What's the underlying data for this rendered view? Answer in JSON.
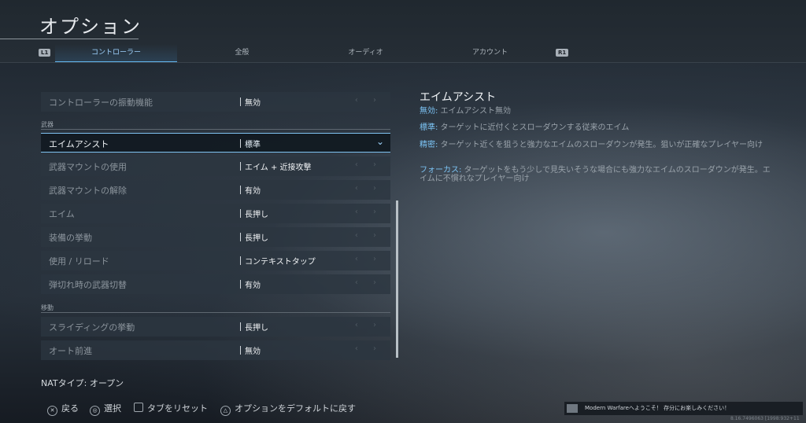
{
  "header": {
    "title": "オプション",
    "bumper_left": "L1",
    "bumper_right": "R1",
    "tabs": [
      {
        "label": "コントローラー"
      },
      {
        "label": "全般"
      },
      {
        "label": "オーディオ"
      },
      {
        "label": "アカウント"
      }
    ]
  },
  "settings": {
    "sections": {
      "weapons": "武器",
      "movement": "移動"
    },
    "rows": [
      {
        "label": "コントローラーの振動機能",
        "value": "無効"
      },
      {
        "label": "エイムアシスト",
        "value": "標準"
      },
      {
        "label": "武器マウントの使用",
        "value": "エイム + 近接攻撃"
      },
      {
        "label": "武器マウントの解除",
        "value": "有効"
      },
      {
        "label": "エイム",
        "value": "長押し"
      },
      {
        "label": "装備の挙動",
        "value": "長押し"
      },
      {
        "label": "使用 / リロード",
        "value": "コンテキストタップ"
      },
      {
        "label": "弾切れ時の武器切替",
        "value": "有効"
      },
      {
        "label": "スライディングの挙動",
        "value": "長押し"
      },
      {
        "label": "オート前進",
        "value": "無効"
      }
    ],
    "selected_index": 1,
    "arrow_glyphs": "‹ ›",
    "chevron_glyph": "⌄"
  },
  "detail": {
    "title": "エイムアシスト",
    "lines": [
      {
        "key": "無効:",
        "text": " エイムアシスト無効"
      },
      {
        "key": "標準:",
        "text": " ターゲットに近付くとスローダウンする従来のエイム"
      },
      {
        "key": "精密:",
        "text": " ターゲット近くを狙うと強力なエイムのスローダウンが発生。狙いが正確なプレイヤー向け"
      },
      {
        "key": "フォーカス:",
        "text": " ターゲットをもう少しで見失いそうな場合にも強力なエイムのスローダウンが発生。エイムに不慣れなプレイヤー向け"
      }
    ]
  },
  "nat": "NATタイプ: オープン",
  "footer": {
    "back": "戻る",
    "select": "選択",
    "reset_tab": "タブをリセット",
    "default": "オプションをデフォルトに戻す",
    "icon_back": "✕",
    "icon_select": "◎",
    "icon_default": "△"
  },
  "toast": {
    "message": "Modern Warfareへようこそ！ 存分にお楽しみください！"
  },
  "version": "8.16.7496063 [1998:932+11"
}
